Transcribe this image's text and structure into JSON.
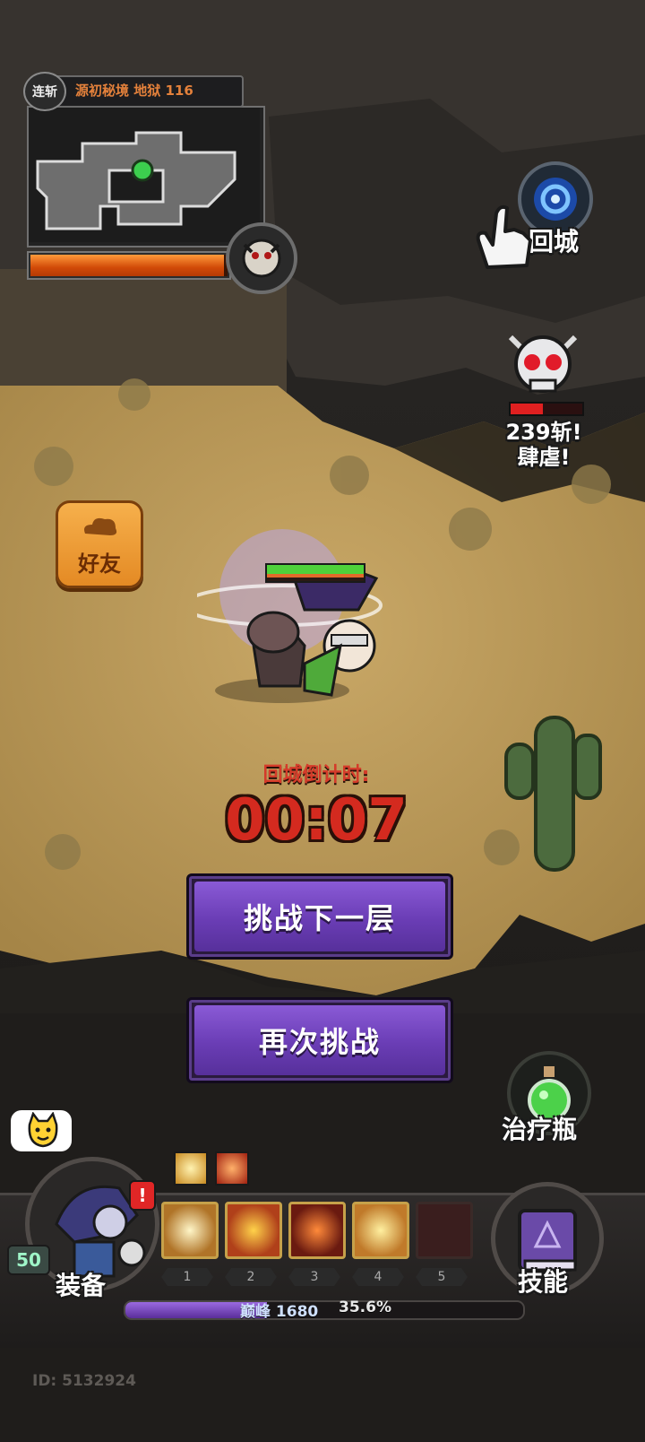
{
  "minimap": {
    "badge": "连斩",
    "title": "源初秘境 地狱 116",
    "progress": 0.98
  },
  "return_city": {
    "label": "回城"
  },
  "kill_counter": {
    "line1": "239斩!",
    "line2": "肆虐!"
  },
  "friends": {
    "label": "好友"
  },
  "countdown": {
    "label": "回城倒计时:",
    "time": "00:07"
  },
  "buttons": {
    "next_floor": "挑战下一层",
    "retry": "再次挑战"
  },
  "potion": {
    "label": "治疗瓶"
  },
  "bottom_bar": {
    "level": "50",
    "equip_label": "装备",
    "skill_label": "技能",
    "slot_numbers": [
      "1",
      "2",
      "3",
      "4",
      "5"
    ],
    "xp_label": "巅峰 1680",
    "xp_percent": "35.6%",
    "xp_fraction": 0.356
  },
  "player_id": "ID: 5132924",
  "colors": {
    "accent_purple": "#6a3db5",
    "countdown_red": "#d42a1f",
    "label_orange": "#e4813b",
    "friend_orange": "#f0a040",
    "hp_green": "#4fd13a"
  }
}
